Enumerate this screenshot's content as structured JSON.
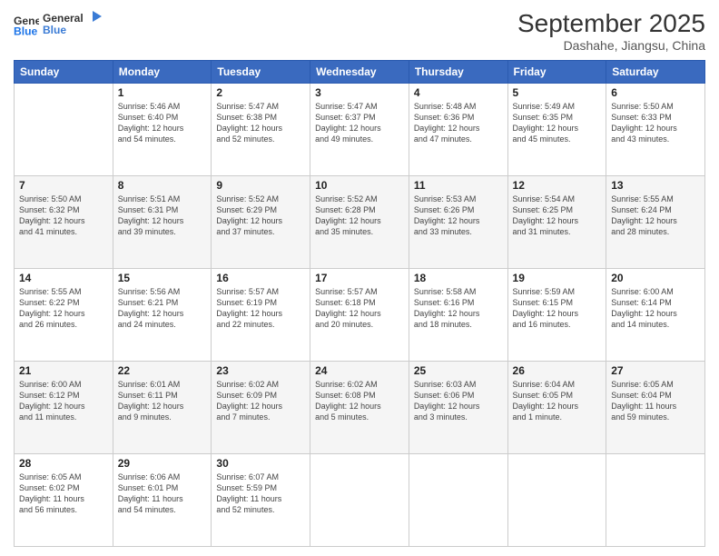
{
  "header": {
    "logo_line1": "General",
    "logo_line2": "Blue",
    "month": "September 2025",
    "location": "Dashahe, Jiangsu, China"
  },
  "days_of_week": [
    "Sunday",
    "Monday",
    "Tuesday",
    "Wednesday",
    "Thursday",
    "Friday",
    "Saturday"
  ],
  "weeks": [
    [
      {
        "day": "",
        "text": ""
      },
      {
        "day": "1",
        "text": "Sunrise: 5:46 AM\nSunset: 6:40 PM\nDaylight: 12 hours\nand 54 minutes."
      },
      {
        "day": "2",
        "text": "Sunrise: 5:47 AM\nSunset: 6:38 PM\nDaylight: 12 hours\nand 52 minutes."
      },
      {
        "day": "3",
        "text": "Sunrise: 5:47 AM\nSunset: 6:37 PM\nDaylight: 12 hours\nand 49 minutes."
      },
      {
        "day": "4",
        "text": "Sunrise: 5:48 AM\nSunset: 6:36 PM\nDaylight: 12 hours\nand 47 minutes."
      },
      {
        "day": "5",
        "text": "Sunrise: 5:49 AM\nSunset: 6:35 PM\nDaylight: 12 hours\nand 45 minutes."
      },
      {
        "day": "6",
        "text": "Sunrise: 5:50 AM\nSunset: 6:33 PM\nDaylight: 12 hours\nand 43 minutes."
      }
    ],
    [
      {
        "day": "7",
        "text": "Sunrise: 5:50 AM\nSunset: 6:32 PM\nDaylight: 12 hours\nand 41 minutes."
      },
      {
        "day": "8",
        "text": "Sunrise: 5:51 AM\nSunset: 6:31 PM\nDaylight: 12 hours\nand 39 minutes."
      },
      {
        "day": "9",
        "text": "Sunrise: 5:52 AM\nSunset: 6:29 PM\nDaylight: 12 hours\nand 37 minutes."
      },
      {
        "day": "10",
        "text": "Sunrise: 5:52 AM\nSunset: 6:28 PM\nDaylight: 12 hours\nand 35 minutes."
      },
      {
        "day": "11",
        "text": "Sunrise: 5:53 AM\nSunset: 6:26 PM\nDaylight: 12 hours\nand 33 minutes."
      },
      {
        "day": "12",
        "text": "Sunrise: 5:54 AM\nSunset: 6:25 PM\nDaylight: 12 hours\nand 31 minutes."
      },
      {
        "day": "13",
        "text": "Sunrise: 5:55 AM\nSunset: 6:24 PM\nDaylight: 12 hours\nand 28 minutes."
      }
    ],
    [
      {
        "day": "14",
        "text": "Sunrise: 5:55 AM\nSunset: 6:22 PM\nDaylight: 12 hours\nand 26 minutes."
      },
      {
        "day": "15",
        "text": "Sunrise: 5:56 AM\nSunset: 6:21 PM\nDaylight: 12 hours\nand 24 minutes."
      },
      {
        "day": "16",
        "text": "Sunrise: 5:57 AM\nSunset: 6:19 PM\nDaylight: 12 hours\nand 22 minutes."
      },
      {
        "day": "17",
        "text": "Sunrise: 5:57 AM\nSunset: 6:18 PM\nDaylight: 12 hours\nand 20 minutes."
      },
      {
        "day": "18",
        "text": "Sunrise: 5:58 AM\nSunset: 6:16 PM\nDaylight: 12 hours\nand 18 minutes."
      },
      {
        "day": "19",
        "text": "Sunrise: 5:59 AM\nSunset: 6:15 PM\nDaylight: 12 hours\nand 16 minutes."
      },
      {
        "day": "20",
        "text": "Sunrise: 6:00 AM\nSunset: 6:14 PM\nDaylight: 12 hours\nand 14 minutes."
      }
    ],
    [
      {
        "day": "21",
        "text": "Sunrise: 6:00 AM\nSunset: 6:12 PM\nDaylight: 12 hours\nand 11 minutes."
      },
      {
        "day": "22",
        "text": "Sunrise: 6:01 AM\nSunset: 6:11 PM\nDaylight: 12 hours\nand 9 minutes."
      },
      {
        "day": "23",
        "text": "Sunrise: 6:02 AM\nSunset: 6:09 PM\nDaylight: 12 hours\nand 7 minutes."
      },
      {
        "day": "24",
        "text": "Sunrise: 6:02 AM\nSunset: 6:08 PM\nDaylight: 12 hours\nand 5 minutes."
      },
      {
        "day": "25",
        "text": "Sunrise: 6:03 AM\nSunset: 6:06 PM\nDaylight: 12 hours\nand 3 minutes."
      },
      {
        "day": "26",
        "text": "Sunrise: 6:04 AM\nSunset: 6:05 PM\nDaylight: 12 hours\nand 1 minute."
      },
      {
        "day": "27",
        "text": "Sunrise: 6:05 AM\nSunset: 6:04 PM\nDaylight: 11 hours\nand 59 minutes."
      }
    ],
    [
      {
        "day": "28",
        "text": "Sunrise: 6:05 AM\nSunset: 6:02 PM\nDaylight: 11 hours\nand 56 minutes."
      },
      {
        "day": "29",
        "text": "Sunrise: 6:06 AM\nSunset: 6:01 PM\nDaylight: 11 hours\nand 54 minutes."
      },
      {
        "day": "30",
        "text": "Sunrise: 6:07 AM\nSunset: 5:59 PM\nDaylight: 11 hours\nand 52 minutes."
      },
      {
        "day": "",
        "text": ""
      },
      {
        "day": "",
        "text": ""
      },
      {
        "day": "",
        "text": ""
      },
      {
        "day": "",
        "text": ""
      }
    ]
  ]
}
